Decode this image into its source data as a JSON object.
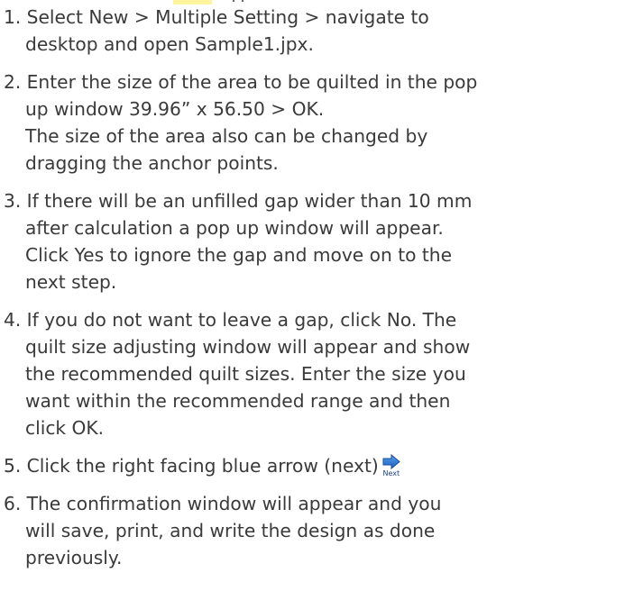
{
  "colors": {
    "text": "#3a3a3a",
    "highlight": "#fff59d",
    "arrow_blue": "#2166c7",
    "arrow_yellow": "#f5c518"
  },
  "steps": [
    {
      "lines": [
        "1. Select New > Multiple Setting > navigate to",
        "desktop and open Sample1.jpx."
      ]
    },
    {
      "lines": [
        "2. Enter the size of the area to be quilted in the pop",
        "up window 39.96” x 56.50 > OK.",
        "The size of the area also can be changed by",
        "dragging the anchor points."
      ]
    },
    {
      "lines": [
        "3. If there will be an unfilled gap wider than 10 mm",
        "after calculation a pop up window will appear.",
        "Click Yes to ignore the gap and move on to the",
        "next step."
      ]
    },
    {
      "lines": [
        "4. If you do not want to leave a gap, click No. The",
        "quilt size adjusting window will appear and show",
        "the recommended quilt sizes. Enter the size you",
        "want within the recommended range and then",
        "click OK."
      ]
    },
    {
      "lines": [
        "5. Click the right facing blue arrow (next)"
      ],
      "icon": {
        "name": "next-arrow-icon",
        "label": "Next"
      }
    },
    {
      "lines": [
        "6. The confirmation window will appear and you",
        "will save, print, and write the design as done",
        "previously."
      ]
    }
  ]
}
